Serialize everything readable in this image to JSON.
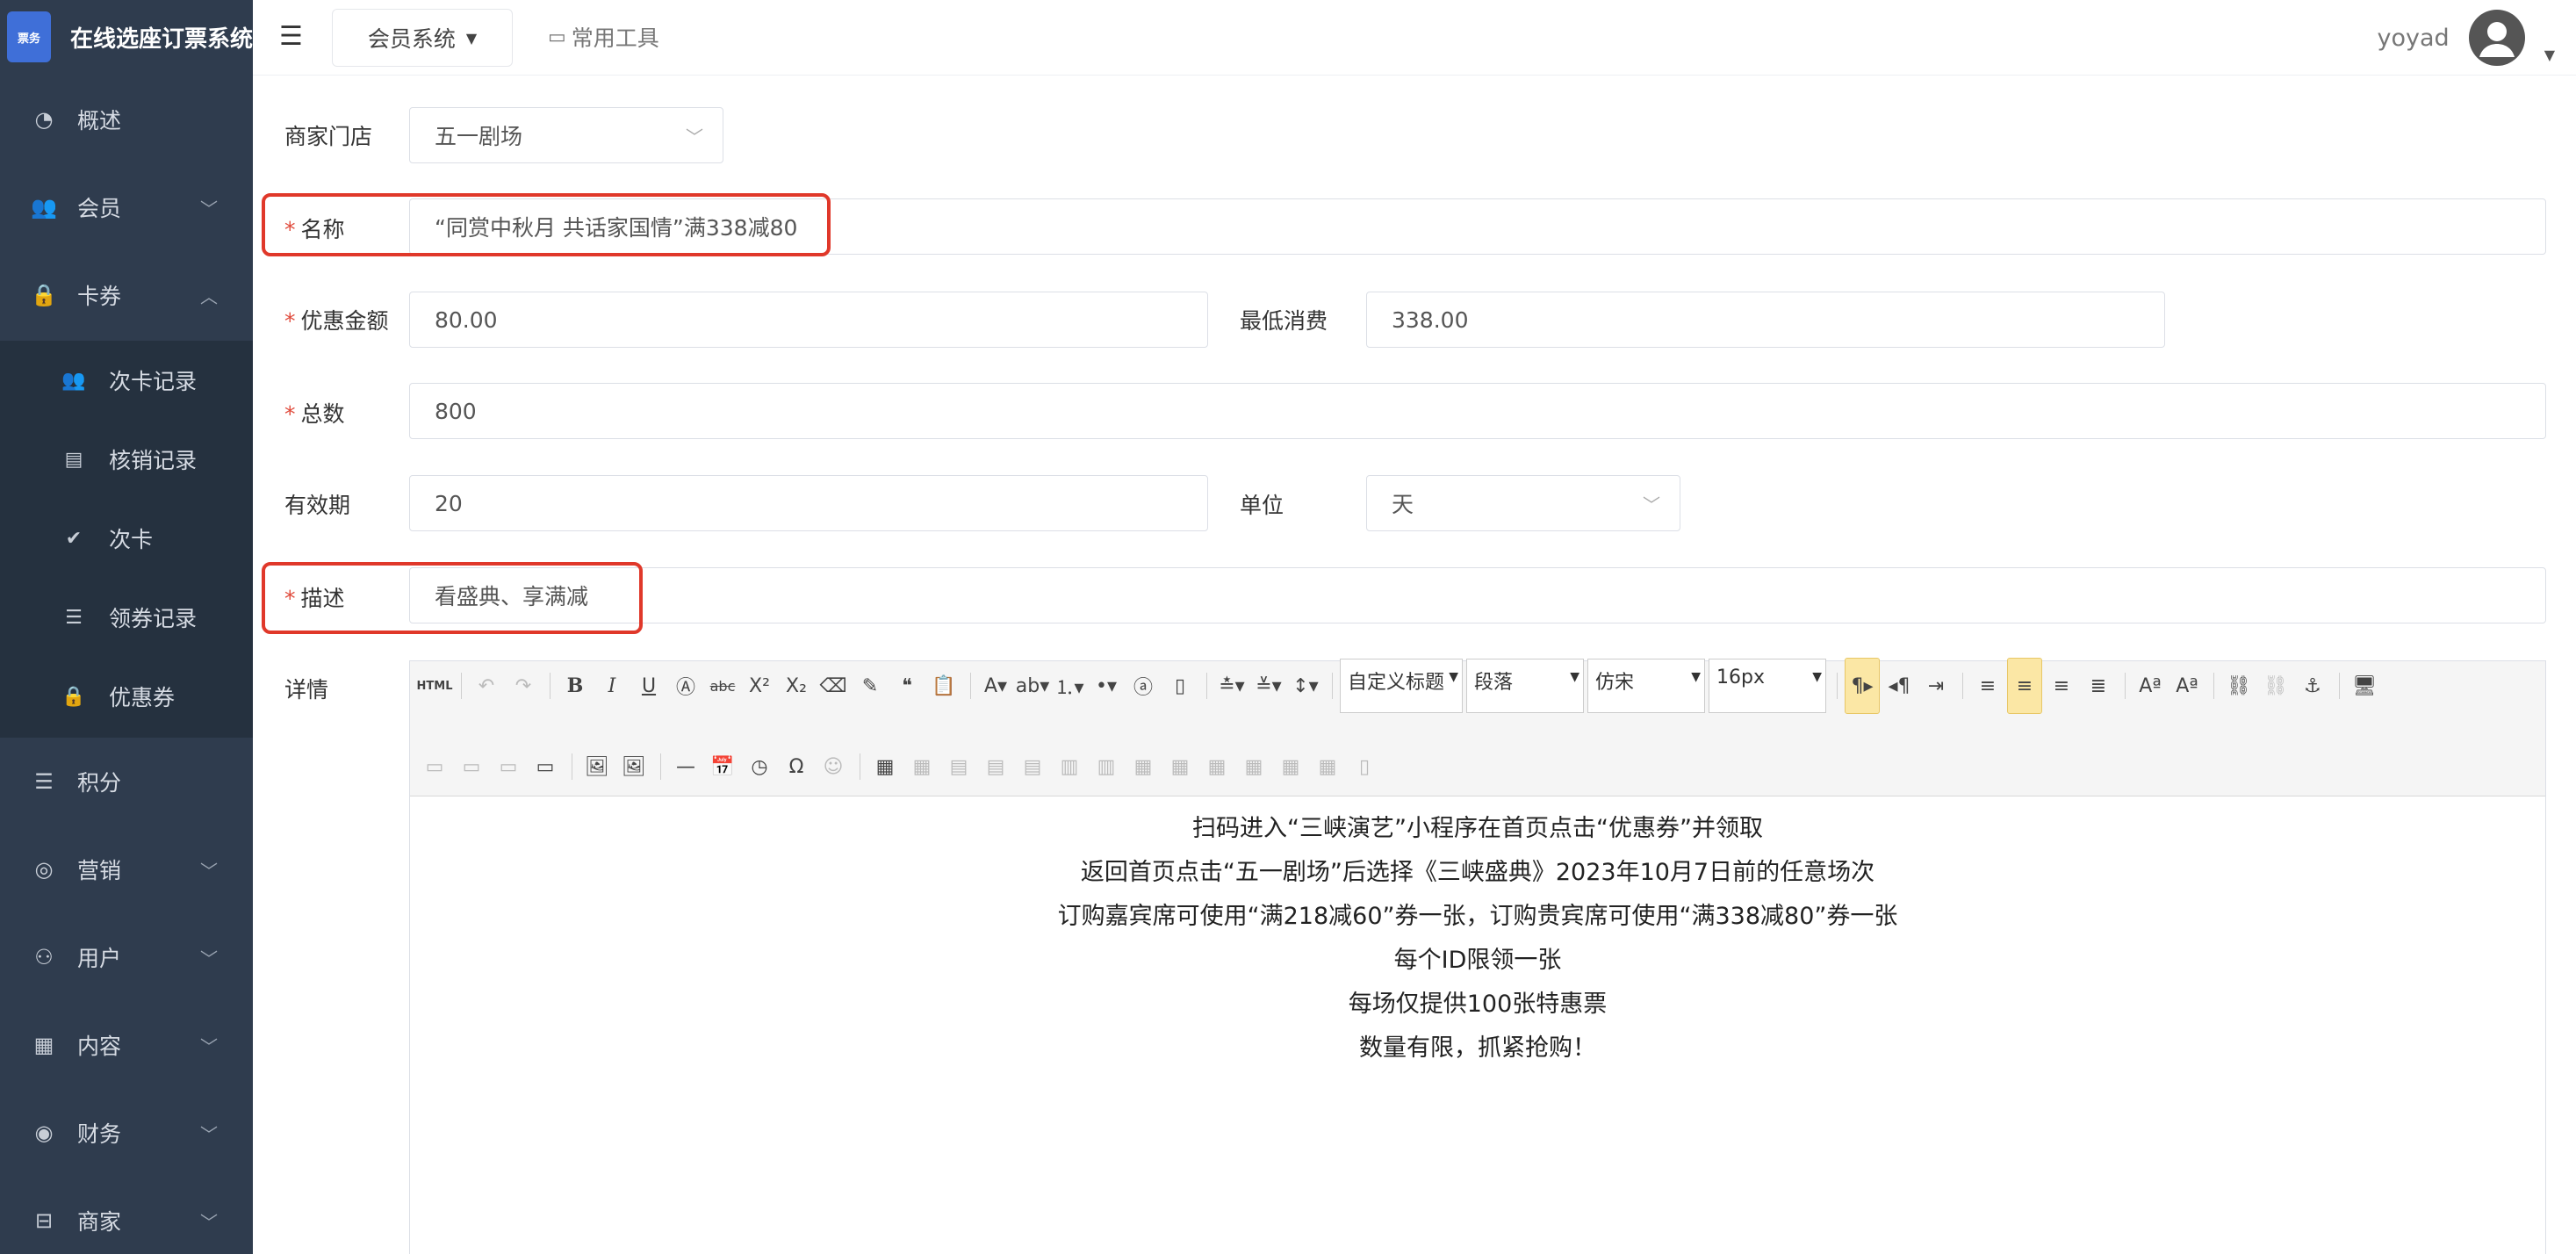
{
  "brand": {
    "title": "在线选座订票系统",
    "logo_text": "票务"
  },
  "sidebar": {
    "items": [
      {
        "label": "概述",
        "icon": "dashboard-icon"
      },
      {
        "label": "会员",
        "icon": "users-icon"
      },
      {
        "label": "卡券",
        "icon": "lock-icon"
      },
      {
        "label": "积分",
        "icon": "list-icon"
      },
      {
        "label": "营销",
        "icon": "target-icon"
      },
      {
        "label": "用户",
        "icon": "user-group-icon"
      },
      {
        "label": "内容",
        "icon": "grid-icon"
      },
      {
        "label": "财务",
        "icon": "finance-icon"
      },
      {
        "label": "商家",
        "icon": "store-icon"
      }
    ],
    "sub_items": [
      {
        "label": "次卡记录",
        "icon": "users-icon"
      },
      {
        "label": "核销记录",
        "icon": "clipboard-icon"
      },
      {
        "label": "次卡",
        "icon": "check-icon"
      },
      {
        "label": "领券记录",
        "icon": "list-icon"
      },
      {
        "label": "优惠券",
        "icon": "lock-icon"
      }
    ]
  },
  "header": {
    "system_dropdown": "会员系统",
    "tools_label": "常用工具",
    "username": "yoyad"
  },
  "form": {
    "store": {
      "label": "商家门店",
      "value": "五一剧场"
    },
    "name": {
      "label": "名称",
      "value": "“同赏中秋月 共话家国情”满338减80"
    },
    "amount": {
      "label": "优惠金额",
      "value": "80.00"
    },
    "min_spend": {
      "label": "最低消费",
      "value": "338.00"
    },
    "total": {
      "label": "总数",
      "value": "800"
    },
    "validity": {
      "label": "有效期",
      "value": "20"
    },
    "unit": {
      "label": "单位",
      "value": "天"
    },
    "desc": {
      "label": "描述",
      "value": "看盛典、享满减"
    },
    "detail": {
      "label": "详情"
    },
    "required_mark": "*"
  },
  "editor": {
    "heading_select": "自定义标题",
    "paragraph_select": "段落",
    "font_select": "仿宋",
    "size_select": "16px",
    "content": [
      "扫码进入“三峡演艺”小程序在首页点击“优惠券”并领取",
      "返回首页点击“五一剧场”后选择《三峡盛典》2023年10月7日前的任意场次",
      "订购嘉宾席可使用“满218减60”券一张，订购贵宾席可使用“满338减80”券一张",
      "每个ID限领一张",
      "每场仅提供100张特惠票",
      "数量有限，抓紧抢购！"
    ]
  },
  "colors": {
    "sidebar": "#2f3c4e",
    "submenu": "#25313f",
    "highlight": "#e0382a",
    "required": "#e04b3c"
  }
}
